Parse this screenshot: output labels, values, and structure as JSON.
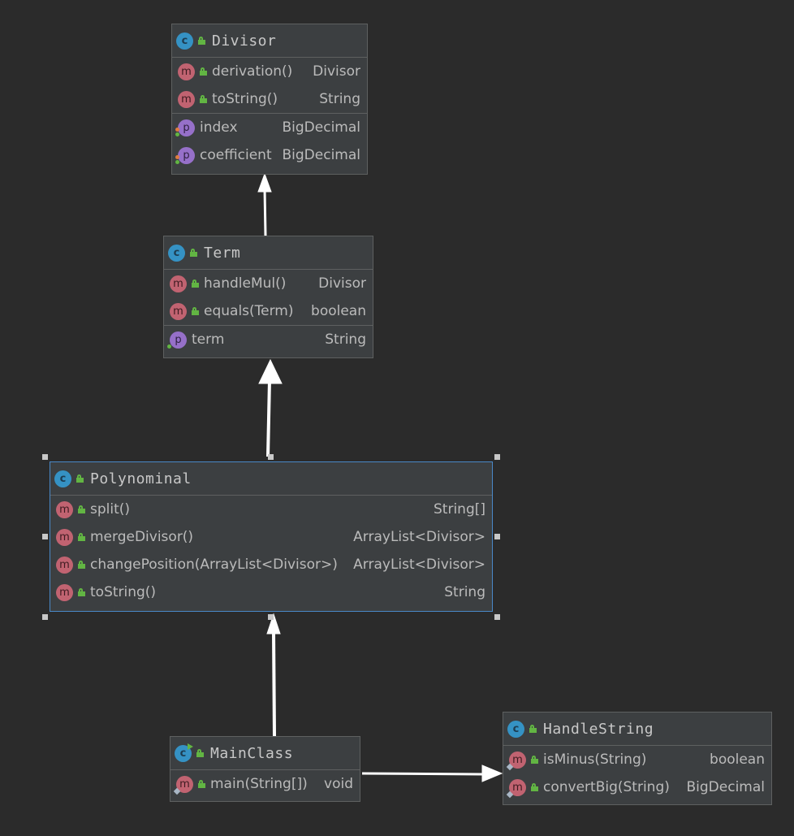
{
  "classes": {
    "divisor": {
      "name": "Divisor",
      "methods": [
        {
          "name": "derivation()",
          "type": "Divisor"
        },
        {
          "name": "toString()",
          "type": "String"
        }
      ],
      "properties": [
        {
          "name": "index",
          "type": "BigDecimal"
        },
        {
          "name": "coefficient",
          "type": "BigDecimal"
        }
      ]
    },
    "term": {
      "name": "Term",
      "methods": [
        {
          "name": "handleMul()",
          "type": "Divisor"
        },
        {
          "name": "equals(Term)",
          "type": "boolean"
        }
      ],
      "properties": [
        {
          "name": "term",
          "type": "String"
        }
      ]
    },
    "polynominal": {
      "name": "Polynominal",
      "methods": [
        {
          "name": "split()",
          "type": "String[]"
        },
        {
          "name": "mergeDivisor()",
          "type": "ArrayList<Divisor>"
        },
        {
          "name": "changePosition(ArrayList<Divisor>)",
          "type": "ArrayList<Divisor>"
        },
        {
          "name": "toString()",
          "type": "String"
        }
      ]
    },
    "mainclass": {
      "name": "MainClass",
      "methods": [
        {
          "name": "main(String[])",
          "type": "void"
        }
      ]
    },
    "handlestring": {
      "name": "HandleString",
      "methods": [
        {
          "name": "isMinus(String)",
          "type": "boolean"
        },
        {
          "name": "convertBig(String)",
          "type": "BigDecimal"
        }
      ]
    }
  },
  "icons": {
    "class": "c",
    "method": "m",
    "property": "p"
  },
  "colors": {
    "background": "#2b2b2b",
    "node": "#3c3f41",
    "selection": "#4a88c7",
    "arrow": "#ffffff"
  }
}
